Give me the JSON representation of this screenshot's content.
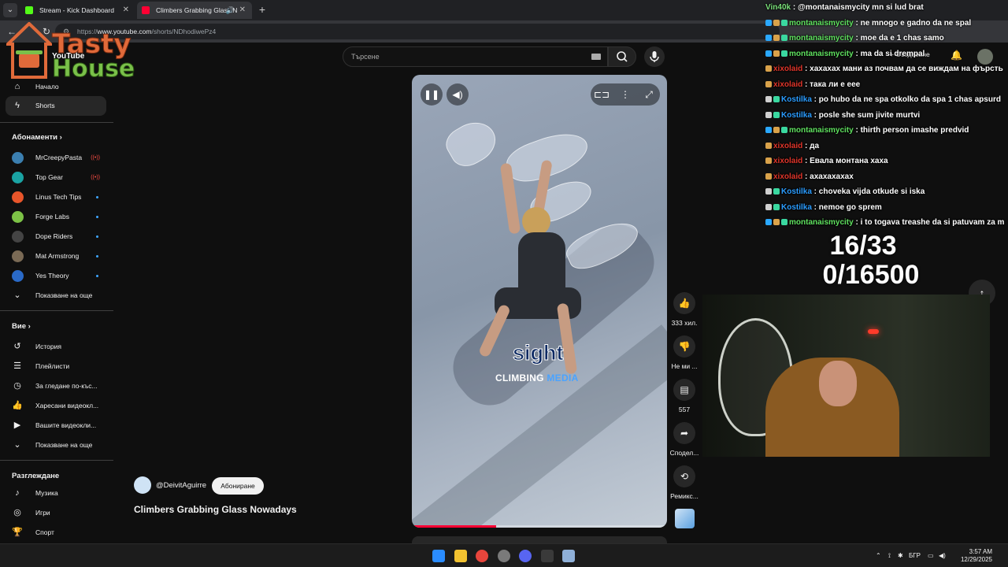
{
  "browser": {
    "tabs": [
      {
        "title": "Stream - Kick Dashboard",
        "favicon_color": "#53fc18"
      },
      {
        "title": "Climbers Grabbing Glass N",
        "favicon_color": "#ff0033"
      }
    ],
    "url_prefix": "https://",
    "url_host": "www.youtube.com",
    "url_path": "/shorts/NDhodiwePz4"
  },
  "logo": {
    "line1": "Tasty",
    "line2": "House",
    "yt_wordmark": "YouTube"
  },
  "search": {
    "placeholder": "Търсене"
  },
  "sidebar": {
    "main": [
      {
        "label": "Начало",
        "icon": "home-icon"
      },
      {
        "label": "Shorts",
        "icon": "shorts-icon"
      }
    ],
    "subscriptions_heading": "Абонаменти",
    "subscriptions": [
      {
        "label": "MrCreepyPasta",
        "color": "#3b7fb0",
        "live": true
      },
      {
        "label": "Top Gear",
        "color": "#1aa3a3",
        "live": true
      },
      {
        "label": "Linus Tech Tips",
        "color": "#e8552a",
        "live": false
      },
      {
        "label": "Forge Labs",
        "color": "#7cc246",
        "live": false
      },
      {
        "label": "Dope Riders",
        "color": "#444444",
        "live": false
      },
      {
        "label": "Mat Armstrong",
        "color": "#7a6a55",
        "live": false
      },
      {
        "label": "Yes Theory",
        "color": "#2a6ac8",
        "live": false
      }
    ],
    "show_more_1": "Показване на още",
    "you_heading": "Вие",
    "you_items": [
      {
        "label": "История",
        "icon": "history-icon"
      },
      {
        "label": "Плейлисти",
        "icon": "playlist-icon"
      },
      {
        "label": "За гледане по-къс...",
        "icon": "clock-icon"
      },
      {
        "label": "Харесани видеокл...",
        "icon": "thumbs-up-icon"
      },
      {
        "label": "Вашите видеокли...",
        "icon": "video-icon"
      }
    ],
    "show_more_2": "Показване на още",
    "explore_heading": "Разглеждане",
    "explore_items": [
      {
        "label": "Музика",
        "icon": "music-icon"
      },
      {
        "label": "Игри",
        "icon": "gamepad-icon"
      },
      {
        "label": "Спорт",
        "icon": "trophy-icon"
      }
    ]
  },
  "video": {
    "overlay_word": "sight",
    "brand_a": "CLIMBING",
    "brand_b": "MEDIA",
    "progress": 0.33
  },
  "actions": {
    "likes": "333 хил.",
    "dislike": "Не ми ...",
    "comments": "557",
    "share": "Сподел...",
    "remix": "Ремикс..."
  },
  "channel": {
    "handle": "@DeivitAguirre",
    "subscribe": "Абониране",
    "title": "Climbers Grabbing Glass Nowadays"
  },
  "chat": [
    {
      "user": "Vin40k",
      "color": "#7ae07a",
      "text": "@montanaismycity mn si lud brat",
      "badges": []
    },
    {
      "user": "montanaismycity",
      "color": "#5fe05f",
      "text": "ne mnogo e gadno da ne spal",
      "badges": [
        "#2aa8ff",
        "#d9a24a",
        "#3ad8a0"
      ]
    },
    {
      "user": "montanaismycity",
      "color": "#5fe05f",
      "text": "moe da e 1 chas samo",
      "badges": [
        "#2aa8ff",
        "#d9a24a",
        "#3ad8a0"
      ]
    },
    {
      "user": "montanaismycity",
      "color": "#5fe05f",
      "text": "ma da si drempal",
      "badges": [
        "#2aa8ff",
        "#d9a24a",
        "#3ad8a0"
      ]
    },
    {
      "user": "xixolaid",
      "color": "#e0352a",
      "text": "хахахах мани аз почвам да се виждам на фърсть",
      "badges": [
        "#d9a24a"
      ]
    },
    {
      "user": "xixolaid",
      "color": "#e0352a",
      "text": "така ли е еее",
      "badges": [
        "#d9a24a"
      ]
    },
    {
      "user": "Kostilka",
      "color": "#2a9cff",
      "text": "po hubo da ne spa otkolko da spa 1 chas apsurd",
      "badges": [
        "#cfcfcf",
        "#3ad8a0"
      ]
    },
    {
      "user": "Kostilka",
      "color": "#2a9cff",
      "text": "posle she sum jivite murtvi",
      "badges": [
        "#cfcfcf",
        "#3ad8a0"
      ]
    },
    {
      "user": "montanaismycity",
      "color": "#5fe05f",
      "text": "thirth person imashe predvid",
      "badges": [
        "#2aa8ff",
        "#d9a24a",
        "#3ad8a0"
      ]
    },
    {
      "user": "xixolaid",
      "color": "#e0352a",
      "text": "да",
      "badges": [
        "#d9a24a"
      ]
    },
    {
      "user": "xixolaid",
      "color": "#e0352a",
      "text": "Евала монтана хаха",
      "badges": [
        "#d9a24a"
      ]
    },
    {
      "user": "xixolaid",
      "color": "#e0352a",
      "text": "ахахахахах",
      "badges": [
        "#d9a24a"
      ]
    },
    {
      "user": "Kostilka",
      "color": "#2a9cff",
      "text": "choveka vijda otkude si iska",
      "badges": [
        "#cfcfcf",
        "#3ad8a0"
      ]
    },
    {
      "user": "Kostilka",
      "color": "#2a9cff",
      "text": "nemoe go sprem",
      "badges": [
        "#cfcfcf",
        "#3ad8a0"
      ]
    },
    {
      "user": "montanaismycity",
      "color": "#5fe05f",
      "text": "i to togava treashe da si patuvam za m",
      "badges": [
        "#2aa8ff",
        "#d9a24a",
        "#3ad8a0"
      ]
    }
  ],
  "counters": {
    "line1": "16/33",
    "line2": "0/16500"
  },
  "yt_header": {
    "create_label": "Създаване"
  },
  "taskbar": {
    "lang": "БГР",
    "time": "3:57 AM",
    "date": "12/29/2025",
    "icons": [
      {
        "name": "windows-start-icon",
        "color": "#2a8cff"
      },
      {
        "name": "file-explorer-icon",
        "color": "#f2c230"
      },
      {
        "name": "chrome-icon",
        "color": "#e8453c"
      },
      {
        "name": "obs-icon",
        "color": "#7a7a7a"
      },
      {
        "name": "discord-icon",
        "color": "#5865f2"
      },
      {
        "name": "terminal-icon",
        "color": "#3a3a3a"
      },
      {
        "name": "settings-icon",
        "color": "#8fb0d8"
      }
    ]
  }
}
